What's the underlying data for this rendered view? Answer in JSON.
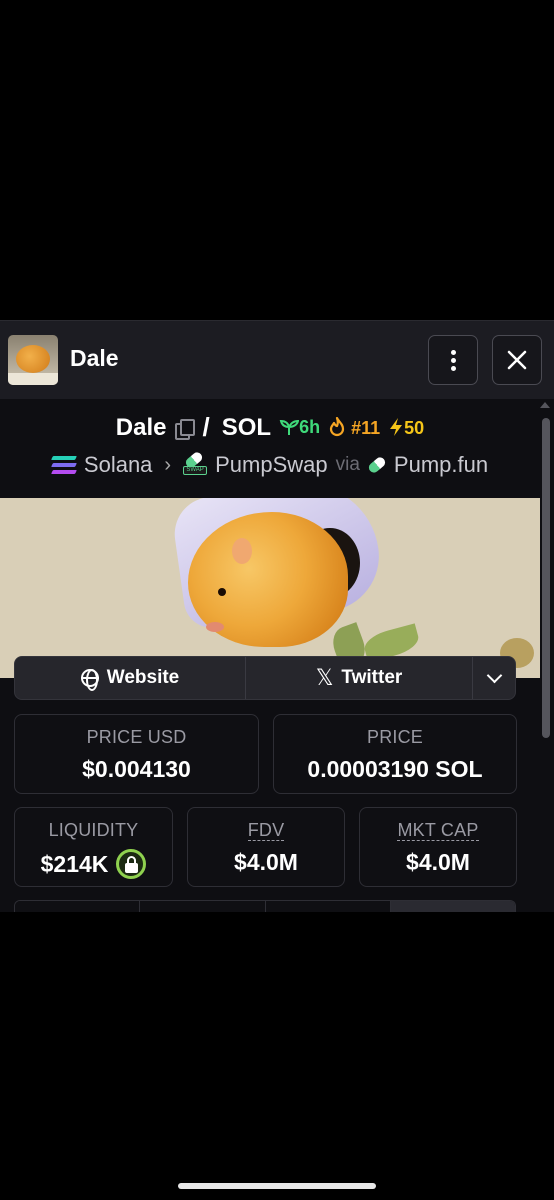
{
  "header": {
    "title": "Dale"
  },
  "pair": {
    "base": "Dale",
    "separator": "/",
    "quote": "SOL",
    "age": "6h",
    "rank": "#11",
    "boosts": "50"
  },
  "chain": {
    "network": "Solana",
    "dex": "PumpSwap",
    "via_label": "via",
    "launchpad": "Pump.fun"
  },
  "links": {
    "website_label": "Website",
    "twitter_label": "Twitter"
  },
  "stats": {
    "price_usd_label": "PRICE USD",
    "price_usd_value": "$0.004130",
    "price_native_label": "PRICE",
    "price_native_value": "0.00003190 SOL",
    "liquidity_label": "LIQUIDITY",
    "liquidity_value": "$214K",
    "fdv_label": "FDV",
    "fdv_value": "$4.0M",
    "mktcap_label": "MKT CAP",
    "mktcap_value": "$4.0M"
  },
  "colors": {
    "age": "#3fd97a",
    "rank": "#f5a524",
    "boost": "#f5c518",
    "lock_ring": "#8fd14f"
  },
  "icons": [
    "copy-icon",
    "seedling-icon",
    "flame-icon",
    "lightning-icon",
    "solana-icon",
    "chevron-right-icon",
    "pumpswap-icon",
    "pumpfun-icon",
    "globe-icon",
    "x-icon",
    "chevron-down-icon",
    "lock-icon",
    "more-vertical-icon",
    "close-icon"
  ]
}
